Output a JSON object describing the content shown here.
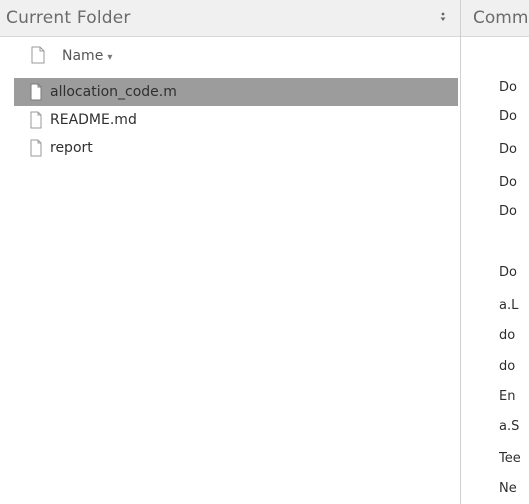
{
  "folder_panel": {
    "title": "Current Folder",
    "menu_icon": "panel-menu-icon",
    "column_header": {
      "name_label": "Name",
      "sort_indicator": "▾"
    },
    "files": [
      {
        "name": "allocation_code.m",
        "selected": true
      },
      {
        "name": "README.md",
        "selected": false
      },
      {
        "name": "report",
        "selected": false
      }
    ]
  },
  "command_panel": {
    "title": "Comm",
    "lines": [
      "Do",
      "Do",
      "Do",
      "Do",
      "Do",
      "Do",
      "a.L",
      "do",
      "do",
      "En",
      "a.S",
      "Tee",
      "Ne"
    ]
  }
}
